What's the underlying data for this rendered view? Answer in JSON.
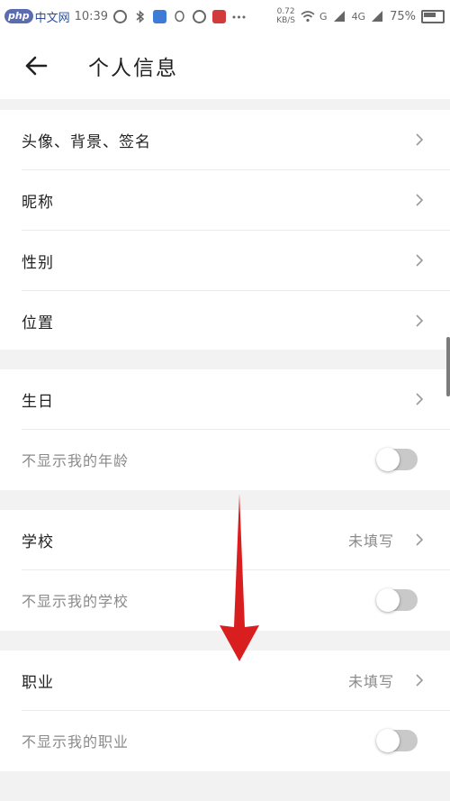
{
  "status_bar": {
    "logo_badge": "php",
    "logo_text": "中文网",
    "time": "10:39",
    "net_speed_value": "0.72",
    "net_speed_unit": "KB/S",
    "sim1": "G",
    "sim2": "4G",
    "battery": "75%"
  },
  "header": {
    "title": "个人信息"
  },
  "groups": {
    "profile": {
      "avatar_bg_signature": "头像、背景、签名",
      "nickname": "昵称",
      "gender": "性别",
      "location": "位置"
    },
    "birthday": {
      "label": "生日",
      "hide_age": "不显示我的年龄"
    },
    "school": {
      "label": "学校",
      "value": "未填写",
      "hide_school": "不显示我的学校"
    },
    "occupation": {
      "label": "职业",
      "value": "未填写",
      "hide_occupation": "不显示我的职业"
    }
  },
  "toggles": {
    "hide_age": false,
    "hide_school": false,
    "hide_occupation": false
  },
  "colors": {
    "background": "#f2f2f2",
    "card": "#ffffff",
    "annotation_arrow": "#d81e1e",
    "toggle_off": "#c9c9c9"
  }
}
